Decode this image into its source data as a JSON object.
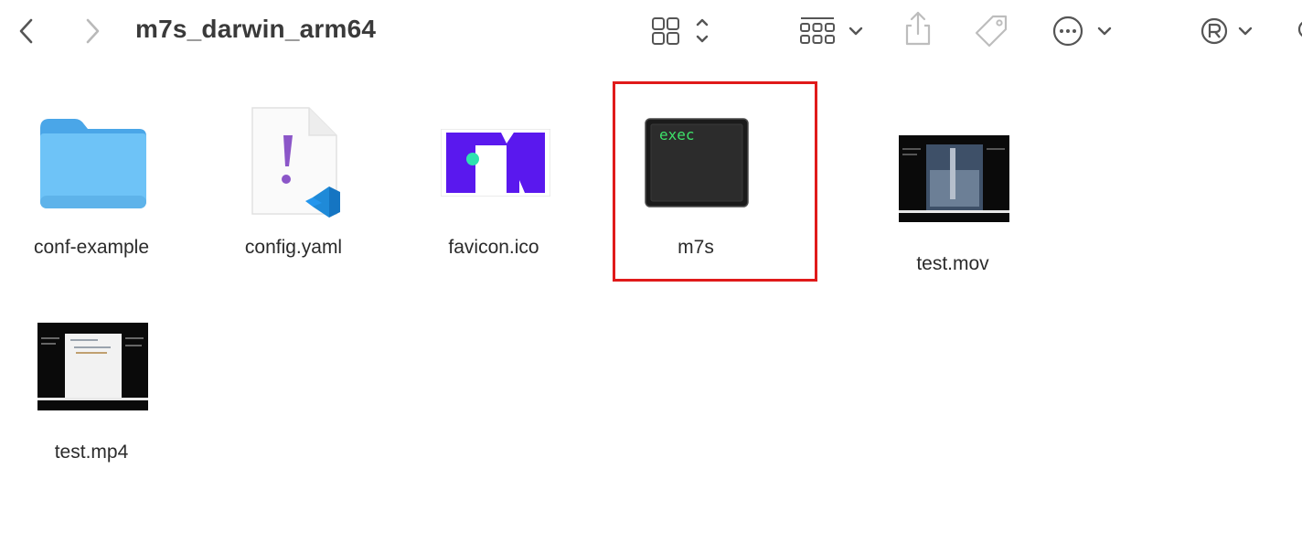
{
  "window": {
    "title": "m7s_darwin_arm64"
  },
  "toolbar": {
    "back_icon": "chevron-left-icon",
    "forward_icon": "chevron-right-icon",
    "view_icon": "grid-view-icon",
    "group_icon": "group-by-icon",
    "share_icon": "share-icon",
    "tag_icon": "tag-icon",
    "more_icon": "more-icon",
    "extension_icon": "registered-icon"
  },
  "files": [
    {
      "name": "conf-example",
      "kind": "folder"
    },
    {
      "name": "config.yaml",
      "kind": "yaml-document"
    },
    {
      "name": "favicon.ico",
      "kind": "icon-image"
    },
    {
      "name": "m7s",
      "kind": "unix-executable",
      "badge": "exec",
      "selected": true
    },
    {
      "name": "test.mov",
      "kind": "video"
    },
    {
      "name": "test.mp4",
      "kind": "video"
    }
  ],
  "colors": {
    "selection_outline": "#e01a1a",
    "folder": "#5eb8f0",
    "favicon": "#5a18ee",
    "exec_text": "#3ee36a"
  }
}
